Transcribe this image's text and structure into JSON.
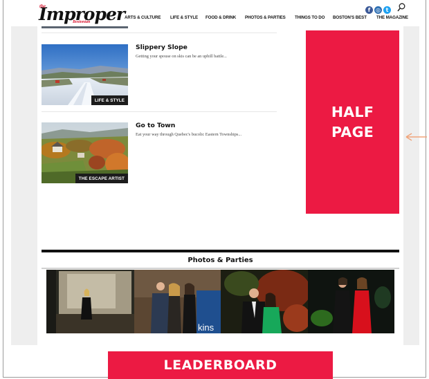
{
  "header": {
    "logo_small": "the",
    "logo": "Improper",
    "logo_sub": "Bostonian",
    "nav": [
      "ARTS & CULTURE",
      "LIFE & STYLE",
      "FOOD & DRINK",
      "PHOTOS & PARTIES",
      "THINGS TO DO",
      "BOSTON'S BEST",
      "THE MAGAZINE"
    ],
    "social": {
      "facebook_glyph": "f",
      "instagram_glyph": "◎",
      "twitter_glyph": "t",
      "colors": {
        "facebook": "#3b5998",
        "instagram": "#2d6fb3",
        "twitter": "#1da1f2"
      }
    }
  },
  "articles": [
    {
      "title": "Slippery Slope",
      "description": "Getting your spouse on skis can be an uphill battle...",
      "category": "LIFE & STYLE"
    },
    {
      "title": "Go to Town",
      "description": "Eat your way through Quebec's bucolic Eastern Townships...",
      "category": "THE ESCAPE ARTIST"
    }
  ],
  "ads": {
    "half_page_line1": "HALF",
    "half_page_line2": "PAGE",
    "leaderboard": "LEADERBOARD",
    "color": "#ec1a43",
    "arrow_color": "#f0a47a"
  },
  "photos_section": {
    "title": "Photos & Parties",
    "photo_caption_fragment": "kins"
  }
}
